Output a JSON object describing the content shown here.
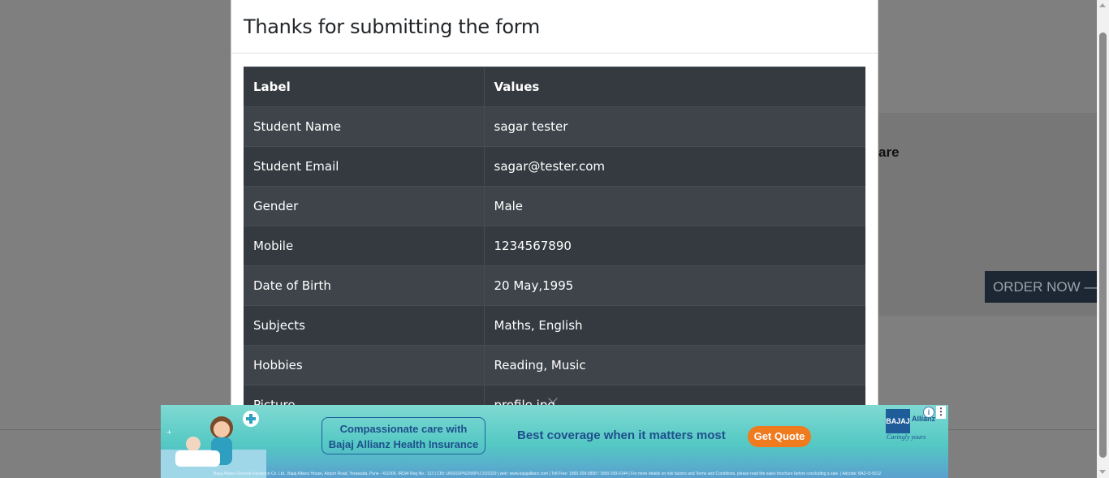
{
  "modal": {
    "title": "Thanks for submitting the form",
    "table": {
      "headers": [
        "Label",
        "Values"
      ],
      "rows": [
        {
          "label": "Student Name",
          "value": "sagar tester"
        },
        {
          "label": "Student Email",
          "value": "sagar@tester.com"
        },
        {
          "label": "Gender",
          "value": "Male"
        },
        {
          "label": "Mobile",
          "value": "1234567890"
        },
        {
          "label": "Date of Birth",
          "value": "20 May,1995"
        },
        {
          "label": "Subjects",
          "value": "Maths, English"
        },
        {
          "label": "Hobbies",
          "value": "Reading, Music"
        },
        {
          "label": "Picture",
          "value": "profile.jpg"
        }
      ]
    }
  },
  "background": {
    "heading_fragment": "are",
    "order_button": "ORDER NOW —"
  },
  "ad": {
    "bubble_line1": "Compassionate care with",
    "bubble_line2": "Bajaj Allianz Health Insurance",
    "tagline": "Best coverage when it matters most",
    "cta": "Get Quote",
    "logo_text": "BAJAJ",
    "brand": "Allianz",
    "brand_tagline": "Caringly yours",
    "fine_print": "Bajaj Allianz General Insurance Co. Ltd., Bajaj Allianz House, Airport Road, Yerawada, Pune - 411006. IRDAI Reg No.: 113 | CIN: U66010PN2000PLC015329 | web: www.bajajallianz.com | Toll Free: 1800-209-5858 / 1800-209-0144 | For more details on risk factors and Terms and Conditions, please read the sales brochure before concluding a sale. | Adcode: BAZ-O-5012",
    "colors": {
      "cta": "#f07b1f",
      "brand": "#1d4f8c"
    }
  }
}
